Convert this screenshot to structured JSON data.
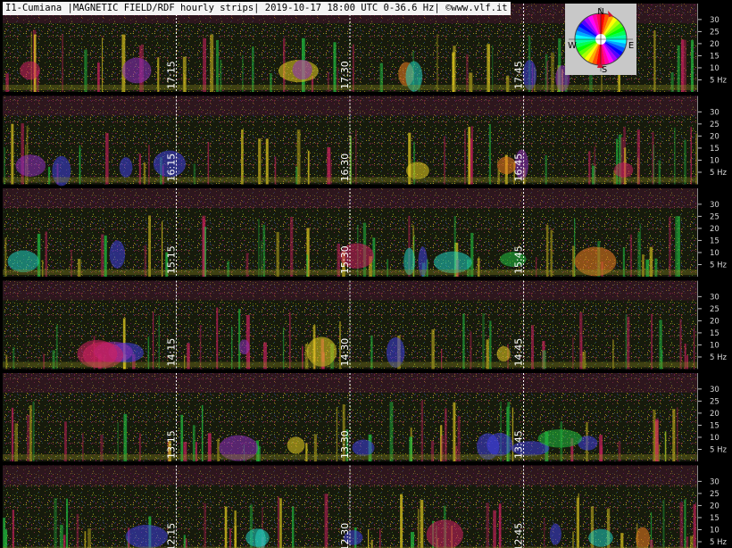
{
  "title": "I1-Cumiana |MAGNETIC FIELD/RDF hourly strips| 2019-10-17 18:00 UTC 0-36.6 Hz| ©www.vlf.it",
  "compass": {
    "n": "N",
    "e": "E",
    "s": "S",
    "w": "W"
  },
  "chart_data": {
    "type": "heatmap",
    "description_free": true,
    "rows": [
      {
        "hour": 17,
        "time_labels": [
          "17:15",
          "17:30",
          "17:45"
        ]
      },
      {
        "hour": 16,
        "time_labels": [
          "16:15",
          "16:30",
          "16:45"
        ]
      },
      {
        "hour": 15,
        "time_labels": [
          "15:15",
          "15:30",
          "15:45"
        ]
      },
      {
        "hour": 14,
        "time_labels": [
          "14:15",
          "14:30",
          "14:45"
        ]
      },
      {
        "hour": 13,
        "time_labels": [
          "13:15",
          "13:30",
          "13:45"
        ]
      },
      {
        "hour": 12,
        "time_labels": [
          "12:15",
          "12:30",
          "12:45"
        ]
      }
    ],
    "y_ticks": [
      "30",
      "25",
      "20",
      "15",
      "10",
      "5 Hz"
    ],
    "y_tick_values": [
      30,
      25,
      20,
      15,
      10,
      5
    ],
    "ylim": [
      0,
      36.6
    ]
  }
}
